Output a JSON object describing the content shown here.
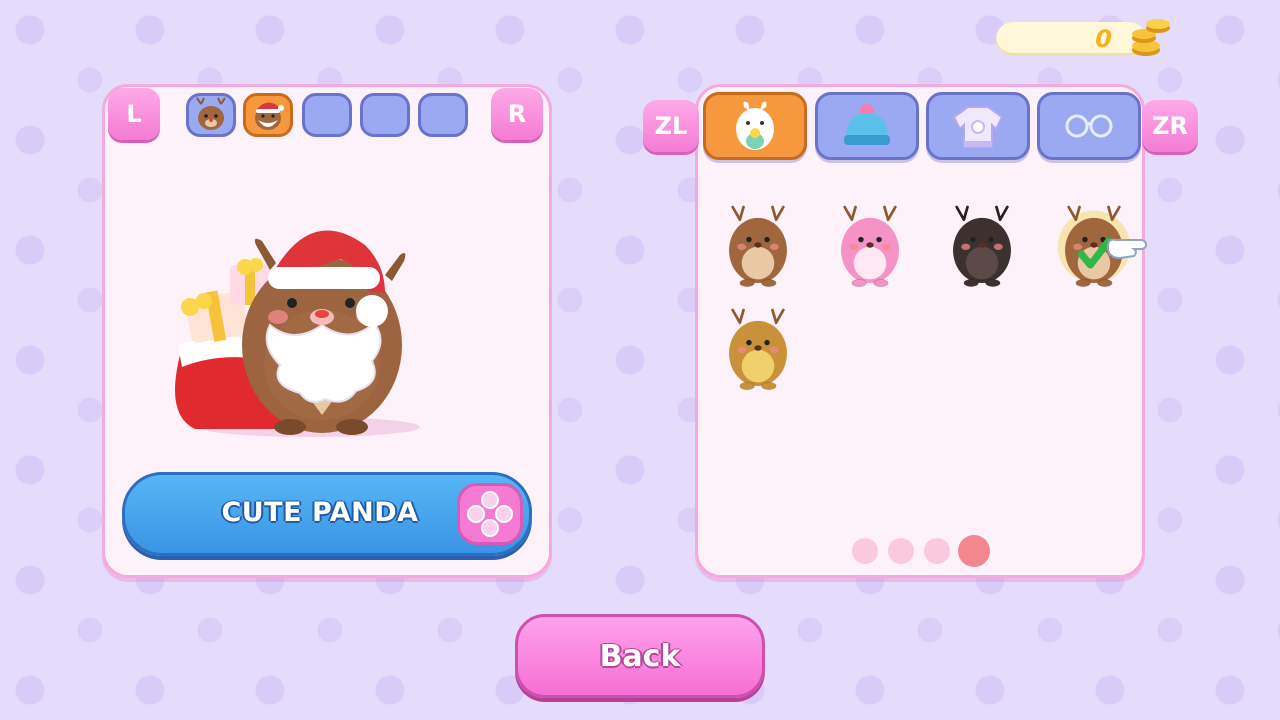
{
  "currency": {
    "coins": "0",
    "icon": "coin-stack-icon"
  },
  "left_panel": {
    "shoulder_left": "L",
    "shoulder_right": "R",
    "preset_slots": [
      {
        "icon": "reindeer-face-icon",
        "filled": true
      },
      {
        "icon": "santa-reindeer-face-icon",
        "filled": true,
        "selected": true
      },
      {
        "filled": false
      },
      {
        "filled": false
      },
      {
        "filled": false
      }
    ],
    "preview_character": "santa-reindeer-with-gift-sack",
    "name": "CUTE PANDA"
  },
  "right_panel": {
    "shoulder_left": "ZL",
    "shoulder_right": "ZR",
    "tabs": [
      {
        "icon": "character-icon",
        "active": true
      },
      {
        "icon": "beanie-hat-icon",
        "active": false
      },
      {
        "icon": "sweater-icon",
        "active": false
      },
      {
        "icon": "glasses-icon",
        "active": false
      }
    ],
    "characters": [
      {
        "color": "brown",
        "fur": "#a0673f",
        "belly": "#e9c9a3"
      },
      {
        "color": "pink",
        "fur": "#f592c6",
        "belly": "#ffe8f4"
      },
      {
        "color": "black",
        "fur": "#3d3130",
        "belly": "#5b4a48"
      },
      {
        "color": "brown",
        "fur": "#a0673f",
        "belly": "#e9c9a3",
        "equipped": true
      },
      {
        "color": "golden",
        "fur": "#c9913a",
        "belly": "#f1cf6a"
      }
    ],
    "pages": {
      "count": 4,
      "current": 4
    }
  },
  "back_button": "Back",
  "colors": {
    "background": "#e5dcfb",
    "panel": "#fdf1fa",
    "panel_border": "#f6a9dd",
    "accent_blue": "#3b94e5",
    "accent_pink": "#f56fd4",
    "accent_orange": "#f5983e",
    "slot_blue": "#9aa9f1"
  }
}
